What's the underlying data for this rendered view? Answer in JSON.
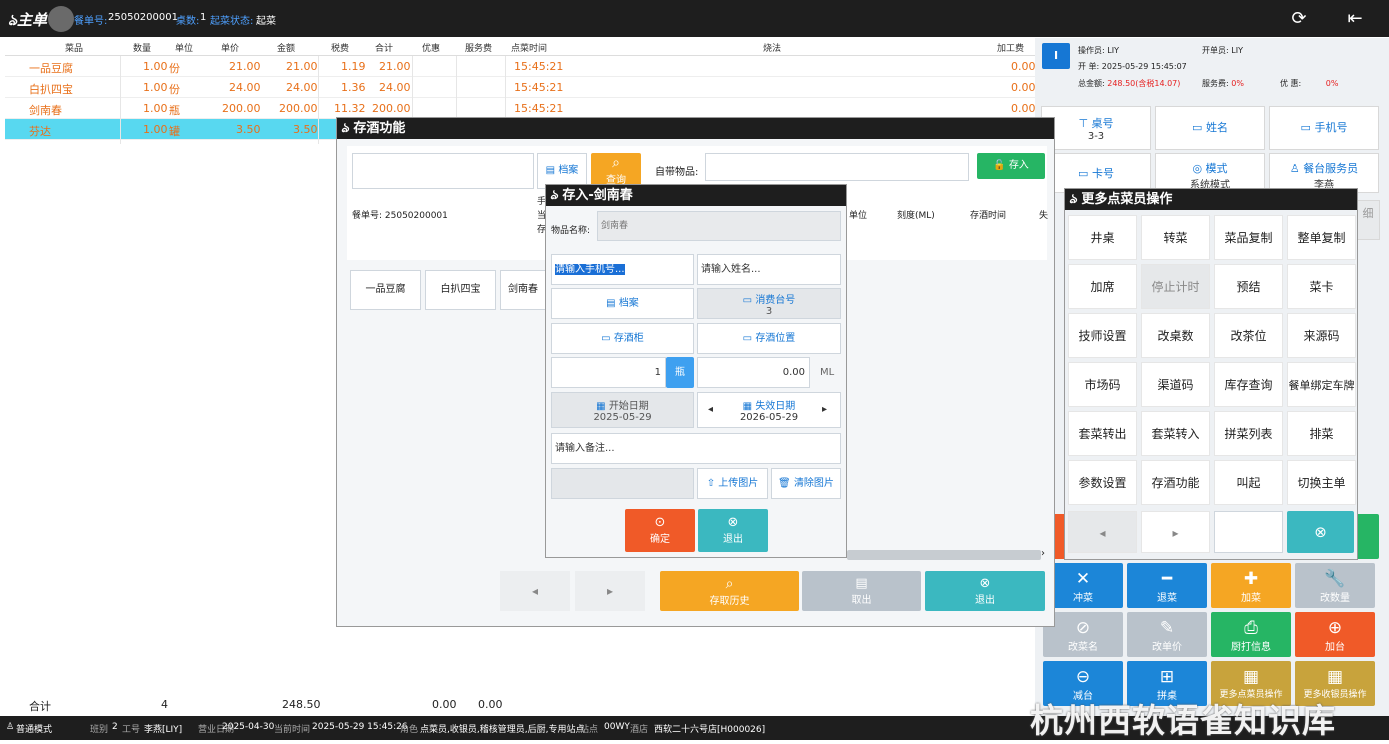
{
  "titlebar": {
    "logo": "ঌ主单",
    "order_label": "餐单号:",
    "order_no": "25050200001",
    "seats_label": "桌数:",
    "seats": "1",
    "status_label": "起菜状态:",
    "status": "起菜",
    "refresh_icon": "refresh-icon",
    "exit_icon": "exit-icon"
  },
  "table": {
    "headers": [
      "菜品",
      "数量",
      "单位",
      "单价",
      "金额",
      "税费",
      "合计",
      "优惠",
      "服务费",
      "点菜时间",
      "烧法",
      "加工费"
    ],
    "rows": [
      {
        "name": "一品豆腐",
        "qty": "1.00",
        "unit": "份",
        "price": "21.00",
        "amount": "21.00",
        "tax": "1.19",
        "total": "21.00",
        "time": "15:45:21",
        "fee": "0.00"
      },
      {
        "name": "白扒四宝",
        "qty": "1.00",
        "unit": "份",
        "price": "24.00",
        "amount": "24.00",
        "tax": "1.36",
        "total": "24.00",
        "time": "15:45:21",
        "fee": "0.00"
      },
      {
        "name": "剑南春",
        "qty": "1.00",
        "unit": "瓶",
        "price": "200.00",
        "amount": "200.00",
        "tax": "11.32",
        "total": "200.00",
        "time": "15:45:21",
        "fee": "0.00"
      },
      {
        "name": "芬达",
        "qty": "1.00",
        "unit": "罐",
        "price": "3.50",
        "amount": "3.50",
        "tax": "",
        "total": "",
        "time": "",
        "fee": ""
      }
    ],
    "total": {
      "label": "合计",
      "qty": "4",
      "amount": "248.50",
      "discount": "0.00",
      "service": "0.00"
    }
  },
  "info": {
    "operator_label": "操作员:",
    "operator": "LIY",
    "opener_label": "开单员:",
    "opener": "LIY",
    "open_label": "开 单:",
    "open_time": "2025-05-29 15:45:07",
    "total_label": "总金额:",
    "total": "248.50(含税14.07)",
    "service_label": "服务费:",
    "service": "0%",
    "discount_label": "优 惠:",
    "discount": "0%",
    "badge": "I"
  },
  "tiles": {
    "table_no": "桌号",
    "table_val": "3-3",
    "name": "姓名",
    "phone": "手机号",
    "card": "卡号",
    "mode": "模式",
    "mode_val": "系统模式",
    "waiter": "餐台服务员",
    "waiter_val": "李燕",
    "detail": "细"
  },
  "actions": {
    "chongcai": "冲菜",
    "tuicai": "退菜",
    "jiacai": "加菜",
    "gaishuliang": "改数量",
    "gaicaiming": "改菜名",
    "gaidanjia": "改单价",
    "chuda": "厨打信息",
    "jiatai": "加台",
    "jiantai": "减台",
    "pinzhuo": "拼桌",
    "more_dish": "更多点菜员操作",
    "more_cash": "更多收银员操作"
  },
  "statusbar": {
    "mode": "普通模式",
    "shift_label": "班别",
    "shift": "2",
    "worker_label": "工号",
    "worker": "李燕[LIY]",
    "bizdate_label": "营业日期",
    "bizdate": "2025-04-30",
    "now_label": "当前时间",
    "now": "2025-05-29 15:45:26",
    "role_label": "角色",
    "role": "点菜员,收银员,稽核管理员,后厨,专用站点",
    "site_label": "站点",
    "site": "00WY",
    "store_label": "酒店",
    "store": "西软二十六号店[H000026]"
  },
  "watermark": "杭州西软语雀知识库",
  "wine_dialog": {
    "title": "存酒功能",
    "archive": "档案",
    "query": "查询",
    "own_item": "自带物品:",
    "store_btn": "存入",
    "order_no": "餐单号: 25050200001",
    "partial": [
      "手",
      "当",
      "存"
    ],
    "cols": [
      "单位",
      "刻度(ML)",
      "存酒时间",
      "失"
    ],
    "dishes": [
      "一品豆腐",
      "白扒四宝",
      "剑南春"
    ],
    "history": "存取历史",
    "cancel": "取出",
    "exit": "退出"
  },
  "deposit_dialog": {
    "title": "存入-剑南春",
    "item_label": "物品名称:",
    "item": "剑南春",
    "phone_ph": "请输入手机号...",
    "name_ph": "请输入姓名...",
    "archive": "档案",
    "consume_table": "消费台号",
    "consume_val": "3",
    "cabinet": "存酒柜",
    "position": "存酒位置",
    "qty": "1",
    "unit": "瓶",
    "ml": "0.00",
    "ml_unit": "ML",
    "start_label": "开始日期",
    "start": "2025-05-29",
    "end_label": "失效日期",
    "end": "2026-05-29",
    "remark_ph": "请输入备注...",
    "upload": "上传图片",
    "clear": "清除图片",
    "confirm": "确定",
    "exit": "退出"
  },
  "more_dialog": {
    "title": "更多点菜员操作",
    "ops": [
      "井桌",
      "转菜",
      "菜品复制",
      "整单复制",
      "加席",
      "停止计时",
      "预结",
      "菜卡",
      "技师设置",
      "改桌数",
      "改茶位",
      "来源码",
      "市场码",
      "渠道码",
      "库存查询",
      "餐单绑定车牌",
      "套菜转出",
      "套菜转入",
      "拼菜列表",
      "排菜",
      "参数设置",
      "存酒功能",
      "叫起",
      "切换主单"
    ]
  },
  "colors": {
    "accent": "#1677d4",
    "orange": "#e8701a",
    "teal": "#3bb8c0",
    "blue_btn": "#1c86d8",
    "green": "#26b564",
    "red_orange": "#f05a28",
    "gold": "#c8a33c"
  }
}
